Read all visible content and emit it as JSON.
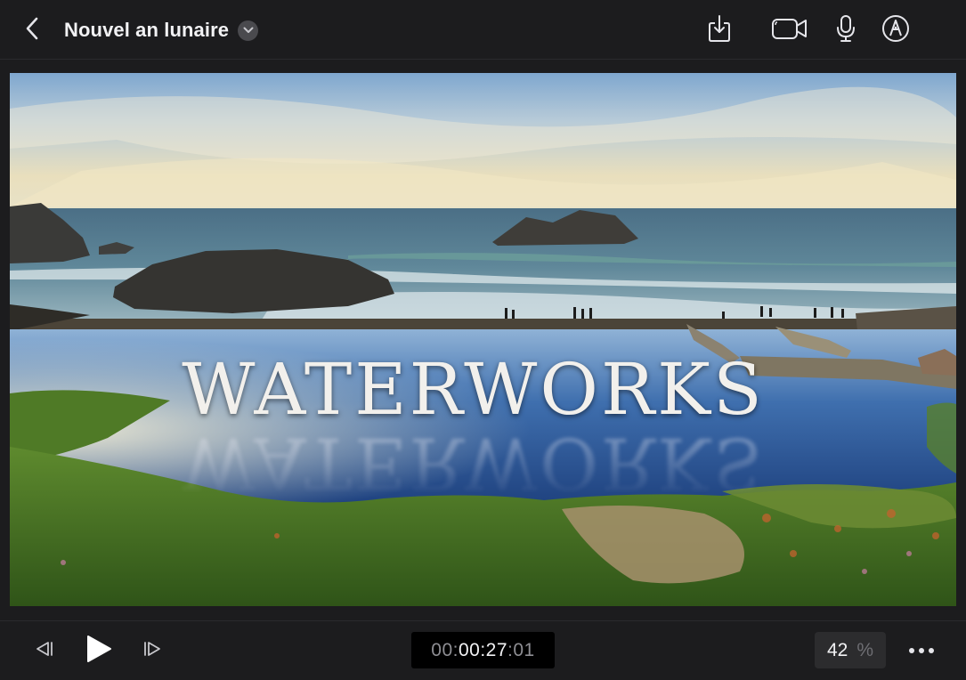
{
  "header": {
    "project_title": "Nouvel an lunaire",
    "icons": {
      "back": "chevron-left-icon",
      "title_menu": "chevron-down-icon",
      "export": "share-download-icon",
      "camera": "video-camera-icon",
      "voiceover": "microphone-icon",
      "markup": "pen-tip-icon"
    }
  },
  "viewer": {
    "overlay_title": "WATERWORKS"
  },
  "transport": {
    "timecode": {
      "dim_part": "00:",
      "bright_part": "00:27",
      "sep": ":",
      "frames": "01"
    },
    "zoom_value": "42",
    "zoom_unit": "%",
    "icons": {
      "prev_frame": "step-backward-icon",
      "play": "play-icon",
      "next_frame": "step-forward-icon",
      "more": "ellipsis-icon"
    }
  },
  "colors": {
    "chrome_bg": "#1c1c1e",
    "text": "#f2f2f4",
    "secondary_text": "#8e8e93"
  }
}
